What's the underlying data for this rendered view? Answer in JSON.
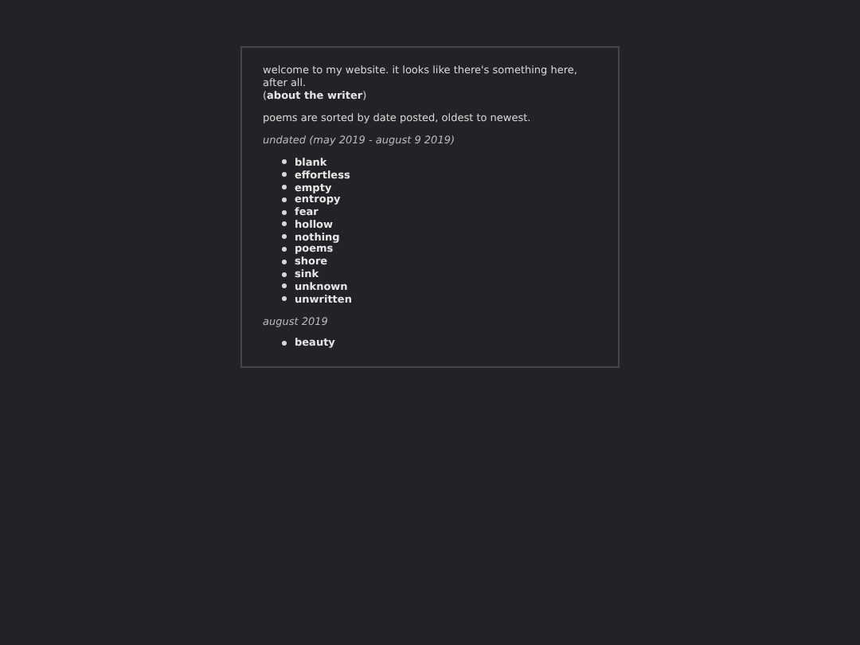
{
  "intro": "welcome to my website. it looks like there's something here, after all.",
  "about_line": {
    "before": "(",
    "link": "about the writer",
    "after": ")"
  },
  "sort_note": "poems are sorted by date posted, oldest to newest.",
  "sections": [
    {
      "heading": "undated (may 2019 - august 9 2019)",
      "poems": [
        "blank",
        "effortless",
        "empty",
        "entropy",
        "fear",
        "hollow",
        "nothing",
        "poems",
        "shore",
        "sink",
        "unknown",
        "unwritten"
      ]
    },
    {
      "heading": "august 2019",
      "poems": [
        "beauty"
      ]
    }
  ]
}
